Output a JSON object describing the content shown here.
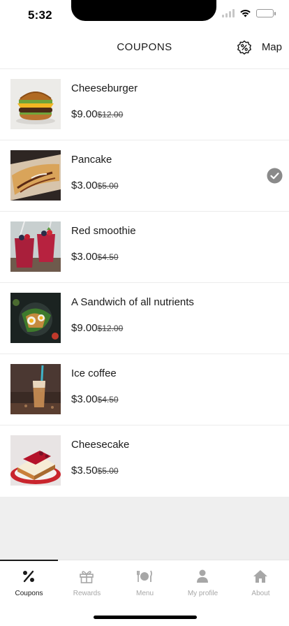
{
  "status_bar": {
    "time": "5:32"
  },
  "header": {
    "title": "COUPONS",
    "map_label": "Map"
  },
  "coupons": [
    {
      "name": "Cheeseburger",
      "price": "$9.00",
      "old_price": "$12.00",
      "image": "cheeseburger-photo",
      "selected": false
    },
    {
      "name": "Pancake",
      "price": "$3.00",
      "old_price": "$5.00",
      "image": "pancake-photo",
      "selected": true
    },
    {
      "name": "Red smoothie",
      "price": "$3.00",
      "old_price": "$4.50",
      "image": "red-smoothie-photo",
      "selected": false
    },
    {
      "name": "A Sandwich of all nutrients",
      "price": "$9.00",
      "old_price": "$12.00",
      "image": "sandwich-photo",
      "selected": false
    },
    {
      "name": "Ice coffee",
      "price": "$3.00",
      "old_price": "$4.50",
      "image": "ice-coffee-photo",
      "selected": false
    },
    {
      "name": "Cheesecake",
      "price": "$3.50",
      "old_price": "$5.00",
      "image": "cheesecake-photo",
      "selected": false
    }
  ],
  "tabs": [
    {
      "label": "Coupons",
      "icon": "percent-icon",
      "active": true
    },
    {
      "label": "Rewards",
      "icon": "gift-icon",
      "active": false
    },
    {
      "label": "Menu",
      "icon": "plate-cutlery-icon",
      "active": false
    },
    {
      "label": "My profile",
      "icon": "user-icon",
      "active": false
    },
    {
      "label": "About",
      "icon": "home-icon",
      "active": false
    }
  ],
  "colors": {
    "active": "#1a1a1a",
    "inactive": "#a7a7a7",
    "check": "#8a8a8a",
    "background": "#efefef"
  }
}
